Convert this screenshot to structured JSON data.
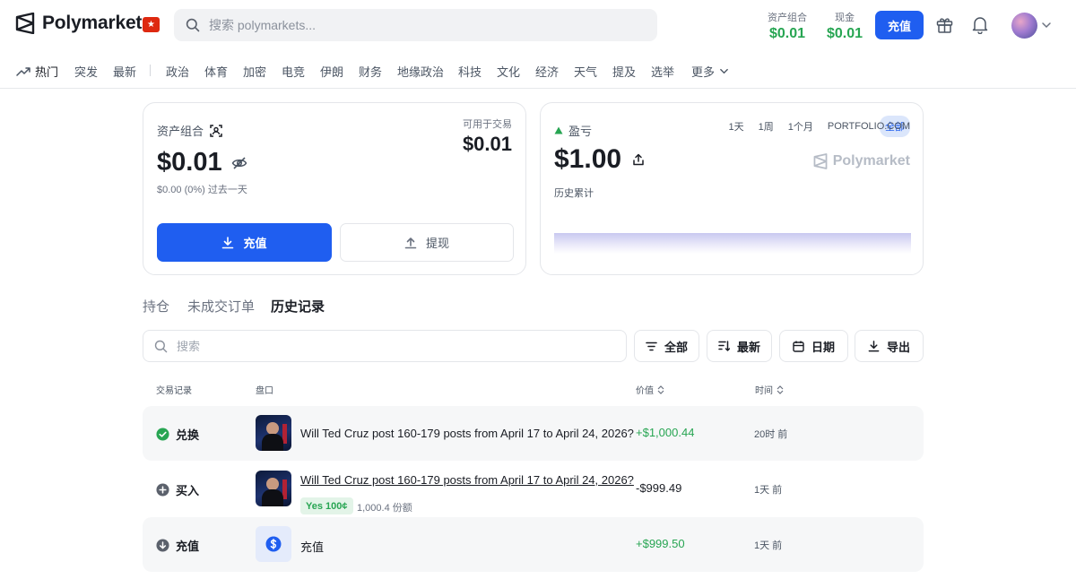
{
  "header": {
    "brand": "Polymarket",
    "flag_glyph": "★",
    "search_placeholder": "搜索 polymarkets...",
    "portfolio_label": "资产组合",
    "portfolio_value": "$0.01",
    "cash_label": "现金",
    "cash_value": "$0.01",
    "deposit_label": "充值",
    "accent_color": "#1f5ef0",
    "positive_color": "#27a552"
  },
  "nav": {
    "items": [
      "热门",
      "突发",
      "最新",
      "政治",
      "体育",
      "加密",
      "电竞",
      "伊朗",
      "财务",
      "地缘政治",
      "科技",
      "文化",
      "经济",
      "天气",
      "提及",
      "选举",
      "更多"
    ]
  },
  "portfolio_card": {
    "label": "资产组合",
    "value": "$0.01",
    "change": "$0.00 (0%) 过去一天",
    "available_label": "可用于交易",
    "available_value": "$0.01",
    "deposit_label": "充值",
    "withdraw_label": "提现"
  },
  "pnl_card": {
    "label": "盈亏",
    "value": "$1.00",
    "sublabel": "历史累计",
    "ranges": [
      "1天",
      "1周",
      "1个月",
      "PORTFOLIO.COM"
    ],
    "range_active": "全部",
    "watermark": "Polymarket"
  },
  "tabs": [
    "持仓",
    "未成交订单",
    "历史记录"
  ],
  "active_tab": "历史记录",
  "filters": {
    "search_placeholder": "搜索",
    "all_label": "全部",
    "sort_label": "最新",
    "date_label": "日期",
    "export_label": "导出"
  },
  "table": {
    "headers": {
      "activity": "交易记录",
      "market": "盘口",
      "value": "价值",
      "time": "时间"
    },
    "rows": [
      {
        "action": "兑换",
        "market": "Will Ted Cruz post 160-179 posts from April 17 to April 24, 2026?",
        "amount": "+$1,000.44",
        "time": "20时 前"
      },
      {
        "action": "买入",
        "market": "Will Ted Cruz post 160-179 posts from April 17 to April 24, 2026?",
        "chip": "Yes 100¢",
        "shares": "1,000.4 份额",
        "amount": "-$999.49",
        "time": "1天 前"
      },
      {
        "action": "充值",
        "market": "充值",
        "amount": "+$999.50",
        "time": "1天 前"
      }
    ]
  }
}
